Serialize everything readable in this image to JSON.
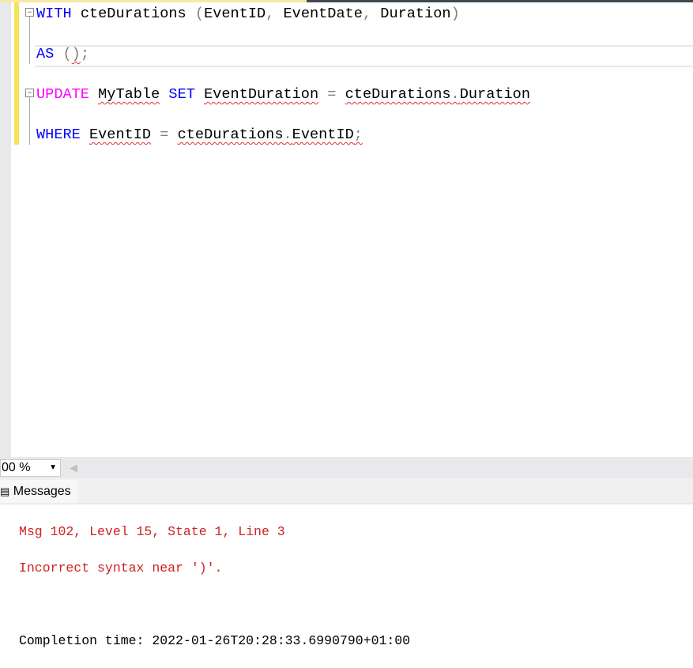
{
  "editor": {
    "line1": {
      "kw": "WITH",
      "name": "cteDurations",
      "open": "(",
      "c1": "EventID",
      "comma1": ",",
      "c2": "EventDate",
      "comma2": ",",
      "c3": "Duration",
      "close": ")"
    },
    "line2": {
      "kw": "AS",
      "paren_open": "(",
      "paren_close": ")",
      "semi": ";"
    },
    "line3": {
      "kw": "UPDATE",
      "table": "MyTable",
      "kw2": "SET",
      "col": "EventDuration",
      "eq": "=",
      "ref": "cteDurations",
      "dot": ".",
      "refcol": "Duration"
    },
    "line4": {
      "kw": "WHERE",
      "col": "EventID",
      "eq": "=",
      "ref": "cteDurations",
      "dot": ".",
      "refcol": "EventID",
      "semi": ";"
    }
  },
  "zoom": {
    "value": "00 %"
  },
  "results": {
    "tab_label": "Messages",
    "error_line1": "Msg 102, Level 15, State 1, Line 3",
    "error_line2": "Incorrect syntax near ')'.",
    "completion": "Completion time: 2022-01-26T20:28:33.6990790+01:00"
  }
}
